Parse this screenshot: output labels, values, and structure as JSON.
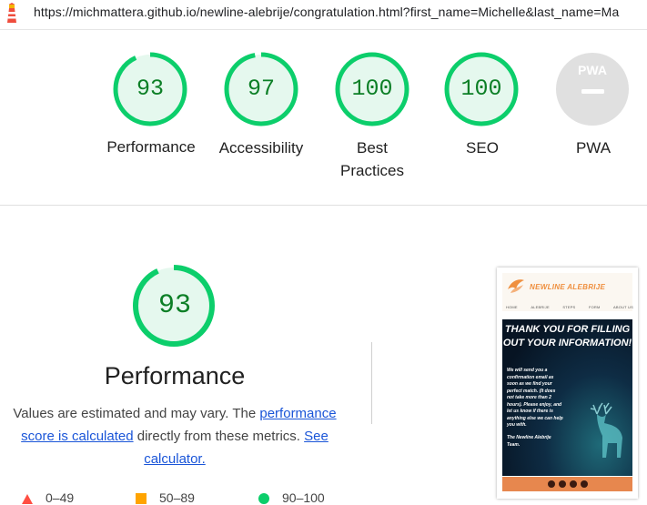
{
  "address_bar": {
    "url": "https://michmattera.github.io/newline-alebrije/congratulation.html?first_name=Michelle&last_name=Ma"
  },
  "colors": {
    "pass": "#0cce6b",
    "pass_fill": "#e5f8ee",
    "pass_text": "#0c7f26",
    "average": "#ffa400",
    "fail": "#ff4e42",
    "na": "#e0e0e0",
    "link": "#1a55d8"
  },
  "summary_gauges": [
    {
      "label": "Performance",
      "score": 93
    },
    {
      "label": "Accessibility",
      "score": 97
    },
    {
      "label": "Best Practices",
      "score": 100
    },
    {
      "label": "SEO",
      "score": 100
    },
    {
      "label": "PWA",
      "badge": "PWA"
    }
  ],
  "performance": {
    "score": "93",
    "title": "Performance",
    "desc_prefix": "Values are estimated and may vary. The ",
    "desc_link1": "performance score is calculated",
    "desc_middle": " directly from these metrics. ",
    "desc_link2": "See calculator."
  },
  "legend": {
    "fail": "0–49",
    "average": "50–89",
    "pass": "90–100"
  },
  "screenshot": {
    "brand": "NEWLINE ALEBRIJE",
    "nav": [
      "HOME",
      "ALEBRIJE",
      "STEPS",
      "FORM",
      "ABOUT US"
    ],
    "title": "THANK YOU FOR FILLING OUT YOUR INFORMATION!",
    "body": "We will send you a confirmation email as soon as we find your perfect match. (It does not take more than 2 hours). Please enjoy, and let us know if there is anything else we can help you with.",
    "team": "The Newline Alebrije Team."
  }
}
